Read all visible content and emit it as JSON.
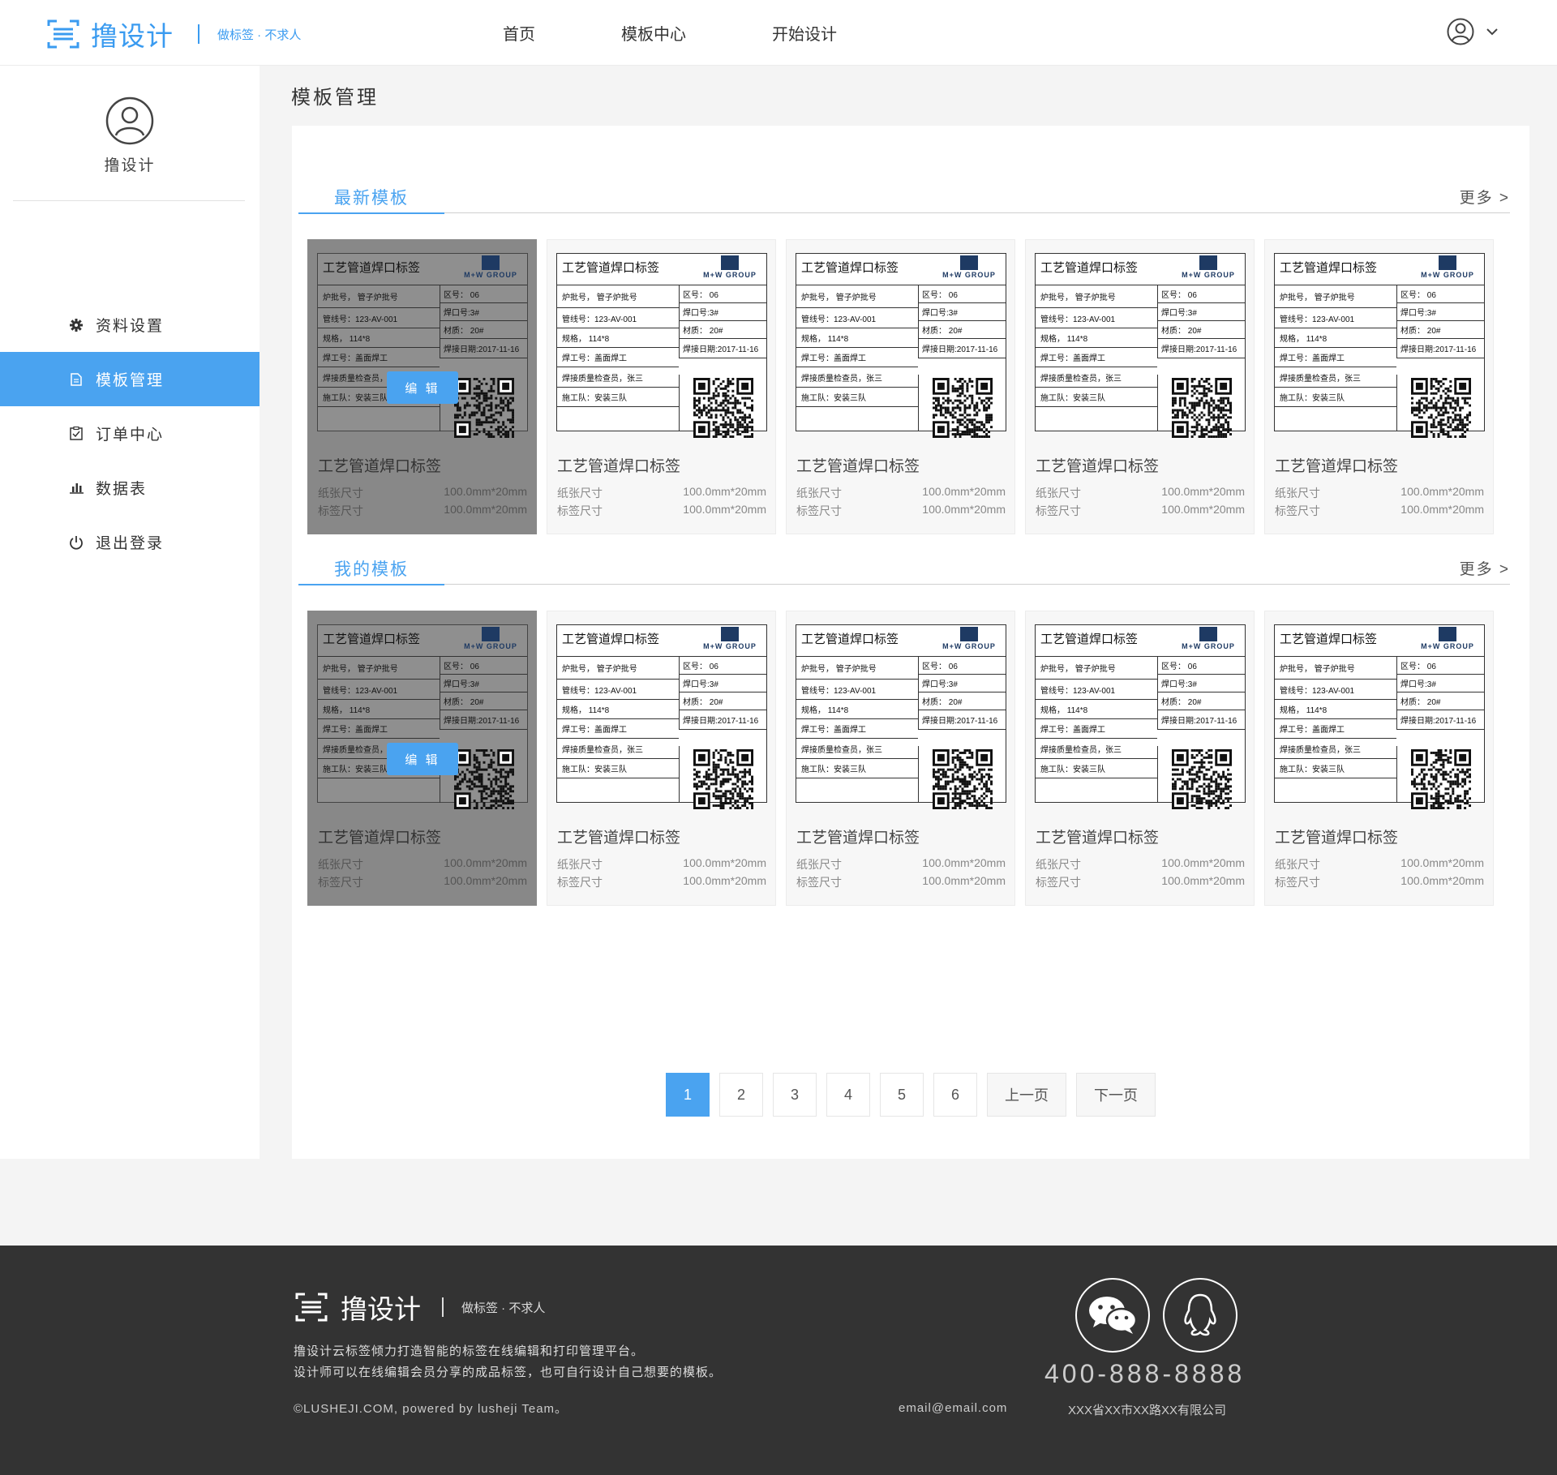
{
  "brand": {
    "name": "撸设计",
    "slogan": "做标签 · 不求人",
    "accent": "#4aa3f0"
  },
  "nav": [
    "首页",
    "模板中心",
    "开始设计"
  ],
  "sidebar": {
    "username": "撸设计",
    "items": [
      {
        "label": "资料设置",
        "icon": "gear-icon",
        "active": false
      },
      {
        "label": "模板管理",
        "icon": "document-icon",
        "active": true
      },
      {
        "label": "订单中心",
        "icon": "checklist-icon",
        "active": false
      },
      {
        "label": "数据表",
        "icon": "bar-chart-icon",
        "active": false
      },
      {
        "label": "退出登录",
        "icon": "power-icon",
        "active": false
      }
    ]
  },
  "page_title": "模板管理",
  "sections": [
    {
      "title": "最新模板",
      "more": "更多 >"
    },
    {
      "title": "我的模板",
      "more": "更多 >"
    }
  ],
  "label_preview": {
    "title": "工艺管道焊口标签",
    "brand": "M+W GROUP",
    "rows_left": [
      "炉批号，  管子炉批号",
      "管线号：123-AV-001",
      "规格，  114*8",
      "焊工号：盖面焊工",
      "焊接质量检查员，张三",
      "施工队：安装三队"
    ],
    "rows_right": [
      "区号：  06",
      "焊口号:3#",
      "材质：  20#",
      "焊接日期:2017-11-16"
    ]
  },
  "card": {
    "name": "工艺管道焊口标签",
    "paper_label": "纸张尺寸",
    "paper_value": "100.0mm*20mm",
    "tag_label": "标签尺寸",
    "tag_value": "100.0mm*20mm",
    "edit_label": "编 辑"
  },
  "pagination": {
    "pages": [
      "1",
      "2",
      "3",
      "4",
      "5",
      "6"
    ],
    "current": "1",
    "prev": "上一页",
    "next": "下一页"
  },
  "footer": {
    "brand": "撸设计",
    "slogan": "做标签 · 不求人",
    "desc1": "撸设计云标签倾力打造智能的标签在线编辑和打印管理平台。",
    "desc2": "设计师可以在线编辑会员分享的成品标签，也可自行设计自己想要的模板。",
    "copyright": "©LUSHEJI.COM, powered by lusheji Team。",
    "phone": "400-888-8888",
    "email": "email@email.com",
    "address": "XXX省XX市XX路XX有限公司"
  }
}
